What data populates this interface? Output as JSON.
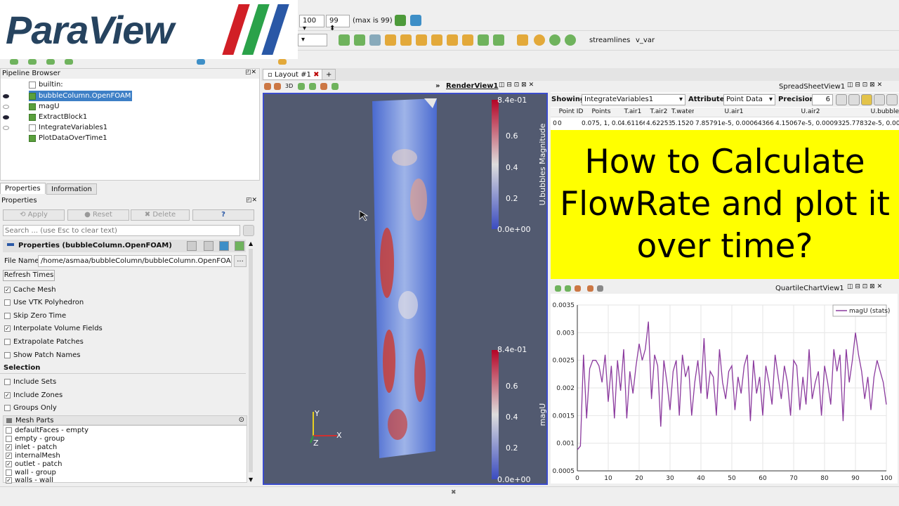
{
  "logo": {
    "text": "ParaView",
    "stripes": [
      "#d11f26",
      "#2ba24a",
      "#2a58a6"
    ]
  },
  "toolbar": {
    "frame_value": "100",
    "frame_max": "99",
    "frame_max_label": "(max is 99)",
    "links": [
      "streamlines",
      "v_var"
    ]
  },
  "pipeline": {
    "title": "Pipeline Browser",
    "root": "builtin:",
    "items": [
      {
        "label": "bubbleColumn.OpenFOAM",
        "visible": true,
        "selected": true
      },
      {
        "label": "magU",
        "visible": false
      },
      {
        "label": "ExtractBlock1",
        "visible": true
      },
      {
        "label": "IntegrateVariables1",
        "visible": false
      },
      {
        "label": "PlotDataOverTime1",
        "visible": false
      }
    ]
  },
  "properties": {
    "tabs": [
      "Properties",
      "Information"
    ],
    "title": "Properties",
    "buttons": {
      "apply": "Apply",
      "reset": "Reset",
      "delete": "Delete",
      "help": "?"
    },
    "search_placeholder": "Search ... (use Esc to clear text)",
    "section_title": "Properties (bubbleColumn.OpenFOAM)",
    "file_name_label": "File Name",
    "file_name_value": "/home/asmaa/bubbleColumn/bubbleColumn.OpenFOAM",
    "browse_label": "...",
    "refresh_label": "Refresh Times",
    "checks": [
      {
        "label": "Cache Mesh",
        "checked": true
      },
      {
        "label": "Use VTK Polyhedron",
        "checked": false
      },
      {
        "label": "Skip Zero Time",
        "checked": false
      },
      {
        "label": "Interpolate Volume Fields",
        "checked": true
      },
      {
        "label": "Extrapolate Patches",
        "checked": false
      },
      {
        "label": "Show Patch Names",
        "checked": false
      }
    ],
    "selection_title": "Selection",
    "selection_checks": [
      {
        "label": "Include Sets",
        "checked": false
      },
      {
        "label": "Include Zones",
        "checked": true
      },
      {
        "label": "Groups Only",
        "checked": false
      }
    ],
    "mesh_parts_title": "Mesh Parts",
    "mesh_parts": [
      {
        "label": "defaultFaces - empty",
        "checked": false
      },
      {
        "label": "empty - group",
        "checked": false
      },
      {
        "label": "inlet - patch",
        "checked": true
      },
      {
        "label": "internalMesh",
        "checked": true
      },
      {
        "label": "outlet - patch",
        "checked": true
      },
      {
        "label": "wall - group",
        "checked": false
      },
      {
        "label": "walls - wall",
        "checked": true
      }
    ]
  },
  "layout": {
    "tab": "Layout #1",
    "add": "+",
    "render_title": "RenderView1",
    "mode_3d": "3D"
  },
  "render": {
    "colorbar_top": {
      "title": "U.bubbles Magnitude",
      "ticks": [
        "8.4e-01",
        "0.6",
        "0.4",
        "0.2",
        "0.0e+00"
      ]
    },
    "colorbar_bottom": {
      "title": "magU",
      "ticks": [
        "8.4e-01",
        "0.6",
        "0.4",
        "0.2",
        "0.0e+00"
      ]
    },
    "axes": {
      "x": "X",
      "y": "Y",
      "z": "Z"
    }
  },
  "spreadsheet": {
    "title": "SpreadSheetView1",
    "showing_label": "Showing",
    "showing_value": "IntegrateVariables1",
    "attribute_label": "Attribute:",
    "attribute_value": "Point Data",
    "precision_label": "Precision:",
    "precision_value": "6",
    "columns": [
      "Point ID",
      "Points",
      "T.air1",
      "T.air2",
      "T.water",
      "U.air1",
      "U.air2",
      "U.bubble"
    ],
    "row": [
      "0",
      "0",
      "0.075, 1, 0.05",
      "4.61166",
      "4.62253",
      "5.15208",
      "7.85791e-5, 0.000643661, 0",
      "4.15067e-5, 0.000932203, 0",
      "5.77832e-5, 0.000"
    ]
  },
  "overlay": {
    "line1": "How to Calculate",
    "line2": "FlowRate and plot it",
    "line3": "over time?"
  },
  "quartile": {
    "title": "QuartileChartView1"
  },
  "chart_data": {
    "type": "line",
    "title": "",
    "xlabel": "",
    "ylabel": "",
    "xlim": [
      0,
      100
    ],
    "ylim": [
      0.0005,
      0.0035
    ],
    "xticks": [
      "0",
      "10",
      "20",
      "30",
      "40",
      "50",
      "60",
      "70",
      "80",
      "90",
      "100"
    ],
    "yticks": [
      "0.0005",
      "0.001",
      "0.0015",
      "0.002",
      "0.0025",
      "0.003",
      "0.0035"
    ],
    "legend_position": "top-right",
    "color": "#8b3a9e",
    "series": [
      {
        "name": "magU (stats)",
        "x": [
          0,
          1,
          2,
          3,
          4,
          5,
          6,
          7,
          8,
          9,
          10,
          11,
          12,
          13,
          14,
          15,
          16,
          17,
          18,
          19,
          20,
          21,
          22,
          23,
          24,
          25,
          26,
          27,
          28,
          29,
          30,
          31,
          32,
          33,
          34,
          35,
          36,
          37,
          38,
          39,
          40,
          41,
          42,
          43,
          44,
          45,
          46,
          47,
          48,
          49,
          50,
          51,
          52,
          53,
          54,
          55,
          56,
          57,
          58,
          59,
          60,
          61,
          62,
          63,
          64,
          65,
          66,
          67,
          68,
          69,
          70,
          71,
          72,
          73,
          74,
          75,
          76,
          77,
          78,
          79,
          80,
          81,
          82,
          83,
          84,
          85,
          86,
          87,
          88,
          89,
          90,
          91,
          92,
          93,
          94,
          95,
          96,
          97,
          98,
          99,
          100
        ],
        "values": [
          0.00088,
          0.00095,
          0.0026,
          0.00145,
          0.00235,
          0.0025,
          0.0025,
          0.0024,
          0.0021,
          0.0026,
          0.00175,
          0.0024,
          0.00145,
          0.0025,
          0.00195,
          0.0027,
          0.00145,
          0.0023,
          0.0019,
          0.0024,
          0.0028,
          0.0025,
          0.0027,
          0.0032,
          0.0018,
          0.0026,
          0.0024,
          0.0013,
          0.0025,
          0.0021,
          0.0016,
          0.0023,
          0.0025,
          0.0015,
          0.0026,
          0.0022,
          0.0024,
          0.0015,
          0.0021,
          0.0025,
          0.0019,
          0.0029,
          0.0018,
          0.0023,
          0.0022,
          0.0015,
          0.0027,
          0.0021,
          0.0018,
          0.0023,
          0.0024,
          0.0016,
          0.0022,
          0.0019,
          0.0024,
          0.0026,
          0.0014,
          0.0025,
          0.0019,
          0.0022,
          0.0015,
          0.0024,
          0.0021,
          0.0017,
          0.0026,
          0.0022,
          0.0018,
          0.0024,
          0.0021,
          0.0015,
          0.0025,
          0.0024,
          0.0016,
          0.0022,
          0.0017,
          0.0027,
          0.0018,
          0.0021,
          0.0023,
          0.0015,
          0.0024,
          0.0021,
          0.0017,
          0.0027,
          0.0023,
          0.0026,
          0.0014,
          0.0027,
          0.0021,
          0.0025,
          0.003,
          0.0026,
          0.0023,
          0.0018,
          0.0022,
          0.0016,
          0.0022,
          0.0025,
          0.0023,
          0.0021,
          0.0017
        ]
      }
    ]
  }
}
